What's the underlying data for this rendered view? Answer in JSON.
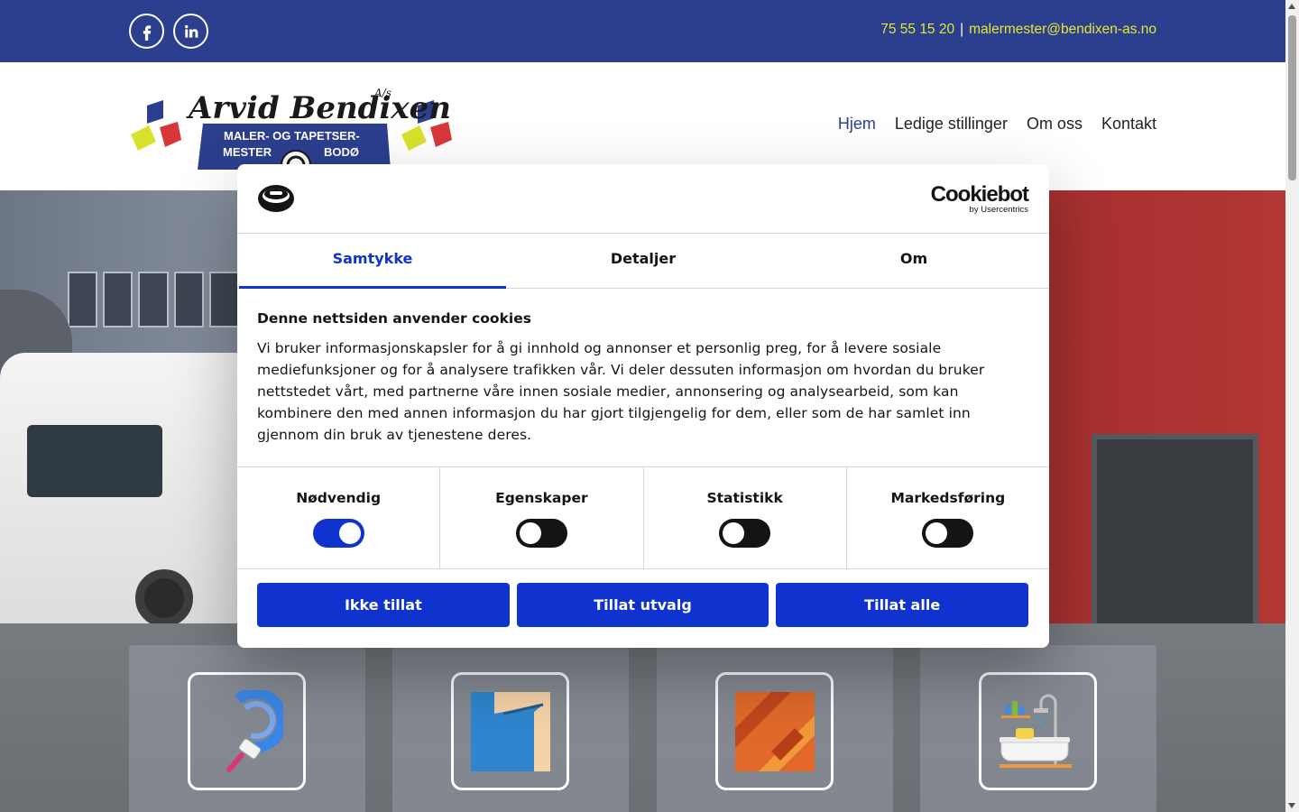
{
  "topbar": {
    "phone": "75 55 15 20",
    "separator": "|",
    "email": "malermester@bendixen-as.no",
    "social": [
      "facebook-icon",
      "linkedin-icon"
    ],
    "bg_color": "#2b3f8e",
    "text_color": "#e6e62e"
  },
  "logo": {
    "line1": "Arvid Bendixen",
    "suffix": "A/s",
    "line2": "MALER- OG TAPETSER-",
    "line3_left": "MESTER",
    "line3_right": "BODØ"
  },
  "nav": {
    "items": [
      "Hjem",
      "Ledige stillinger",
      "Om oss",
      "Kontakt"
    ],
    "active": "Hjem"
  },
  "services": [
    {
      "icon": "paint-roller-icon"
    },
    {
      "icon": "wallpaper-icon"
    },
    {
      "icon": "flooring-icon"
    },
    {
      "icon": "bathroom-icon"
    }
  ],
  "cookie_dialog": {
    "brand_name": "Cookiebot",
    "brand_by": "by Usercentrics",
    "tabs": [
      "Samtykke",
      "Detaljer",
      "Om"
    ],
    "active_tab": "Samtykke",
    "title": "Denne nettsiden anvender cookies",
    "body": "Vi bruker informasjonskapsler for å gi innhold og annonser et personlig preg, for å levere sosiale mediefunksjoner og for å analysere trafikken vår. Vi deler dessuten informasjon om hvordan du bruker nettstedet vårt, med partnerne våre innen sosiale medier, annonsering og analysearbeid, som kan kombinere den med annen informasjon du har gjort tilgjengelig for dem, eller som de har samlet inn gjennom din bruk av tjenestene deres.",
    "toggles": [
      {
        "label": "Nødvendig",
        "on": true
      },
      {
        "label": "Egenskaper",
        "on": false
      },
      {
        "label": "Statistikk",
        "on": false
      },
      {
        "label": "Markedsføring",
        "on": false
      }
    ],
    "buttons": {
      "deny": "Ikke tillat",
      "allow_selection": "Tillat utvalg",
      "allow_all": "Tillat alle"
    },
    "accent_color": "#1032cf"
  }
}
